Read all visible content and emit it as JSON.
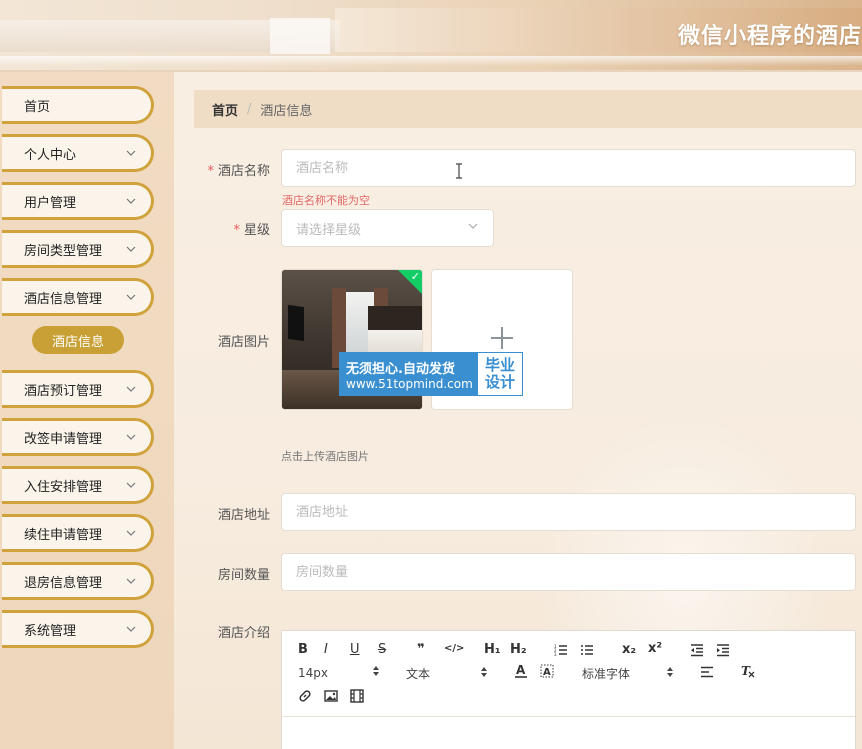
{
  "header": {
    "title": "微信小程序的酒店"
  },
  "sidebar": {
    "items": [
      {
        "label": "首页",
        "has_chevron": false
      },
      {
        "label": "个人中心",
        "has_chevron": true
      },
      {
        "label": "用户管理",
        "has_chevron": true
      },
      {
        "label": "房间类型管理",
        "has_chevron": true
      },
      {
        "label": "酒店信息管理",
        "has_chevron": true
      },
      {
        "label": "酒店预订管理",
        "has_chevron": true
      },
      {
        "label": "改签申请管理",
        "has_chevron": true
      },
      {
        "label": "入住安排管理",
        "has_chevron": true
      },
      {
        "label": "续住申请管理",
        "has_chevron": true
      },
      {
        "label": "退房信息管理",
        "has_chevron": true
      },
      {
        "label": "系统管理",
        "has_chevron": true
      }
    ],
    "active_sub_item": "酒店信息"
  },
  "breadcrumb": {
    "home": "首页",
    "separator": "/",
    "current": "酒店信息"
  },
  "form": {
    "hotel_name": {
      "label": "酒店名称",
      "required_mark": "*",
      "placeholder": "酒店名称",
      "value": "",
      "error": "酒店名称不能为空"
    },
    "star_rating": {
      "label": "星级",
      "required_mark": "*",
      "placeholder": "请选择星级"
    },
    "hotel_image": {
      "label": "酒店图片",
      "hint": "点击上传酒店图片",
      "uploaded": true
    },
    "address": {
      "label": "酒店地址",
      "placeholder": "酒店地址",
      "value": ""
    },
    "room_count": {
      "label": "房间数量",
      "placeholder": "房间数量",
      "value": ""
    },
    "intro": {
      "label": "酒店介绍"
    }
  },
  "watermark": {
    "line1": "无须担心.自动发货",
    "line2": "www.51topmind.com",
    "badge_line1": "毕业",
    "badge_line2": "设计"
  },
  "editor": {
    "toolbar_row1": [
      "B",
      "I",
      "U",
      "S",
      "❞",
      "</>",
      "H₁",
      "H₂",
      "ordered-list",
      "bullet-list",
      "x₂",
      "x²",
      "outdent",
      "indent"
    ],
    "font_size": "14px",
    "text_style": "文本",
    "font_family": "标准字体"
  },
  "colors": {
    "accent": "#c9a035",
    "menu_border": "#cfa23b",
    "error": "#e06a6a",
    "success": "#13ce66",
    "watermark_blue": "#3a8fd0"
  }
}
